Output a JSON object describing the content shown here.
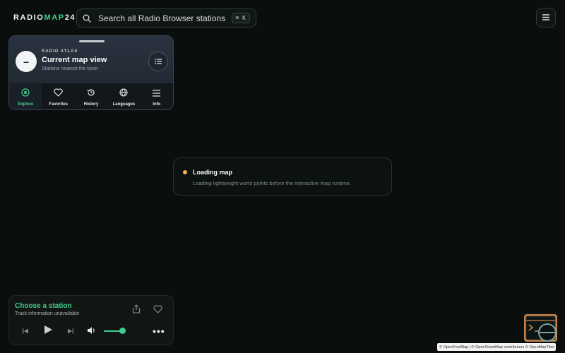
{
  "brand": {
    "prefix": "RADIO",
    "accent": "MAP",
    "suffix": "24",
    "accent_color": "#3ecf8e"
  },
  "search": {
    "placeholder": "Search all Radio Browser stations",
    "shortcut": "⌘ K",
    "icon": "search-icon"
  },
  "header": {
    "menu_icon": "hamburger-icon"
  },
  "panel": {
    "eyebrow": "RADIO ATLAS",
    "title": "Current map view",
    "subtitle": "Stations nearest the tuner",
    "collapse_symbol": "–",
    "list_icon": "list-icon",
    "tabs": [
      {
        "label": "Explore",
        "icon": "compass-icon",
        "active": true
      },
      {
        "label": "Favorites",
        "icon": "heart-icon",
        "active": false
      },
      {
        "label": "History",
        "icon": "history-icon",
        "active": false
      },
      {
        "label": "Languages",
        "icon": "globe-icon",
        "active": false
      },
      {
        "label": "Info",
        "icon": "menu-icon",
        "active": false
      }
    ]
  },
  "loading": {
    "title": "Loading map",
    "message": "Loading lightweight world points before the interactive map runtime.",
    "status_color": "#f5b642"
  },
  "player": {
    "title": "Choose a station",
    "subtitle": "Track information unavailable",
    "volume": 0.85,
    "more_label": "•••"
  },
  "attribution": {
    "openfreemap": "© OpenFreeMap",
    "osm": "© OpenStreetMap contributors",
    "openmaptiles": "© OpenMapTiles"
  }
}
